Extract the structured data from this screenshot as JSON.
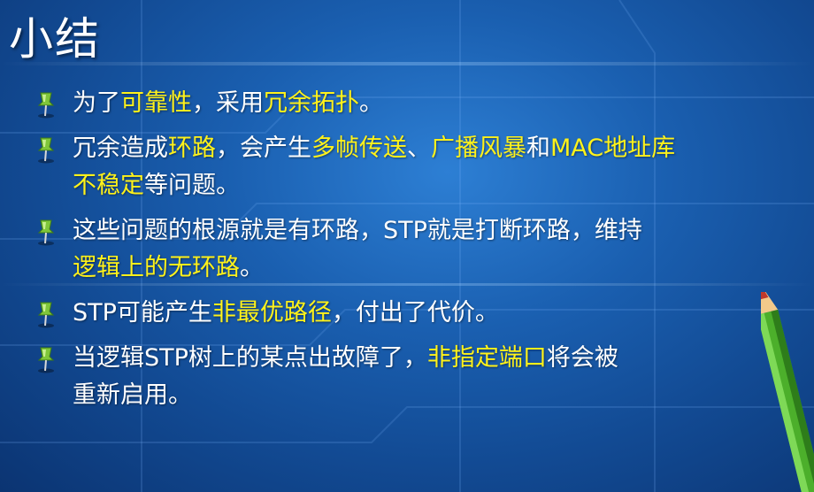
{
  "title": "小结",
  "bullets": [
    {
      "lines": [
        [
          {
            "text": "为了",
            "hl": false
          },
          {
            "text": "可靠性",
            "hl": true
          },
          {
            "text": "，采用",
            "hl": false
          },
          {
            "text": "冗余拓扑",
            "hl": true
          },
          {
            "text": "。",
            "hl": false
          }
        ]
      ]
    },
    {
      "lines": [
        [
          {
            "text": "冗余造成",
            "hl": false
          },
          {
            "text": "环路",
            "hl": true
          },
          {
            "text": "，会产生",
            "hl": false
          },
          {
            "text": "多帧传送",
            "hl": true
          },
          {
            "text": "、",
            "hl": false
          },
          {
            "text": "广播风暴",
            "hl": true
          },
          {
            "text": "和",
            "hl": false
          },
          {
            "text": "MAC地址库",
            "hl": true
          }
        ],
        [
          {
            "text": "不稳定",
            "hl": true
          },
          {
            "text": "等问题。",
            "hl": false
          }
        ]
      ]
    },
    {
      "lines": [
        [
          {
            "text": "这些问题的根源就是有环路，STP就是打断环路，维持",
            "hl": false
          }
        ],
        [
          {
            "text": "逻辑上的无环路",
            "hl": true
          },
          {
            "text": "。",
            "hl": false
          }
        ]
      ]
    },
    {
      "lines": [
        [
          {
            "text": "STP可能产生",
            "hl": false
          },
          {
            "text": "非最优路径",
            "hl": true
          },
          {
            "text": "，付出了代价。",
            "hl": false
          }
        ]
      ]
    },
    {
      "lines": [
        [
          {
            "text": "当逻辑STP树上的某点出故障了，",
            "hl": false
          },
          {
            "text": "非指定端口",
            "hl": true
          },
          {
            "text": "将会被",
            "hl": false
          }
        ],
        [
          {
            "text": "重新启用。",
            "hl": false
          }
        ]
      ]
    }
  ],
  "colors": {
    "highlight": "#fff21a",
    "text": "#ffffff",
    "background": "#1a5fb0"
  },
  "icons": {
    "bullet": "pushpin-icon",
    "decoration": "pencil-icon"
  }
}
